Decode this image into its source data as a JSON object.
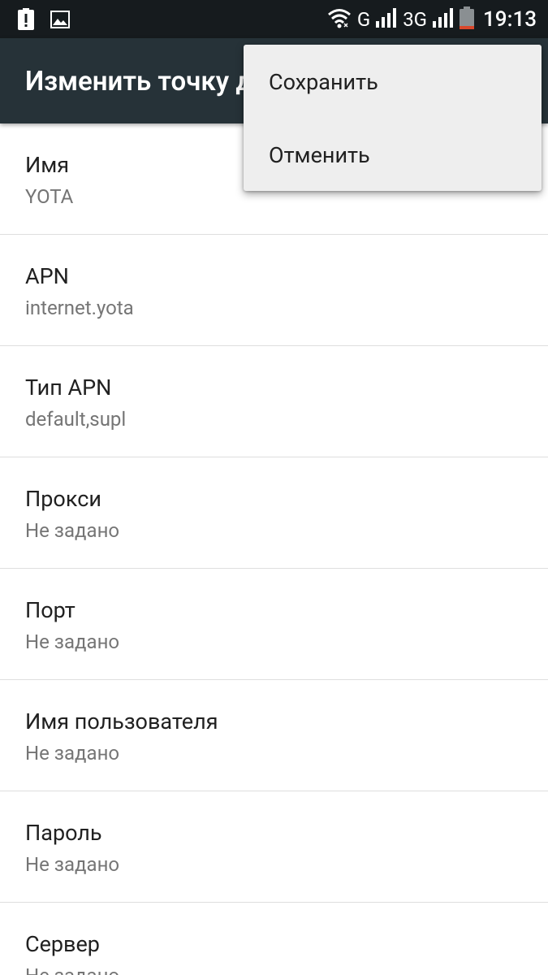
{
  "status_bar": {
    "left_icons": [
      "alert-icon",
      "image-icon"
    ],
    "network_g": "G",
    "network_3g": "3G",
    "time": "19:13",
    "battery_color": "#d9472b"
  },
  "toolbar": {
    "title": "Изменить точку доступа"
  },
  "menu": {
    "items": [
      {
        "label": "Сохранить"
      },
      {
        "label": "Отменить"
      }
    ]
  },
  "preferences": [
    {
      "title": "Имя",
      "summary": "YOTA"
    },
    {
      "title": "APN",
      "summary": "internet.yota"
    },
    {
      "title": "Тип APN",
      "summary": "default,supl"
    },
    {
      "title": "Прокси",
      "summary": "Не задано"
    },
    {
      "title": "Порт",
      "summary": "Не задано"
    },
    {
      "title": "Имя пользователя",
      "summary": "Не задано"
    },
    {
      "title": "Пароль",
      "summary": "Не задано"
    },
    {
      "title": "Сервер",
      "summary": "Не задано"
    }
  ],
  "colors": {
    "status_bar": "#161b1e",
    "toolbar": "#263238",
    "menu_bg": "#eeeeee",
    "primary_text": "#212121",
    "secondary_text": "#757575"
  }
}
